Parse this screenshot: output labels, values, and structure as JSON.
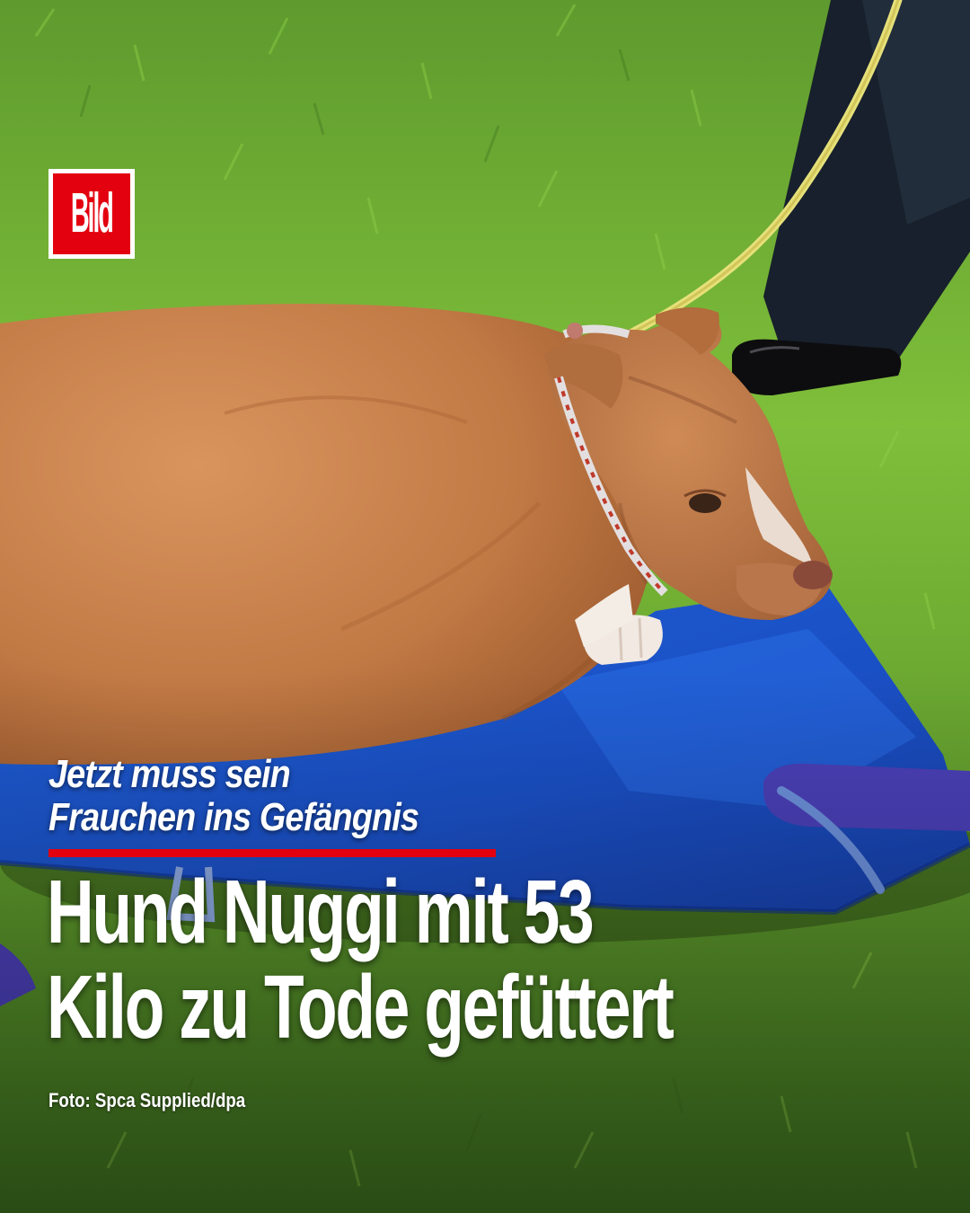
{
  "brand": {
    "logo_text": "Bild",
    "logo_color": "#e3000f"
  },
  "post": {
    "kicker_line1": "Jetzt muss sein",
    "kicker_line2": "Frauchen ins Gefängnis",
    "headline_line1": "Hund Nuggi mit 53",
    "headline_line2": "Kilo zu Tode gefüttert",
    "photo_credit": "Foto: Spca Supplied/dpa"
  },
  "colors": {
    "accent_red": "#e3000f",
    "text": "#ffffff"
  }
}
